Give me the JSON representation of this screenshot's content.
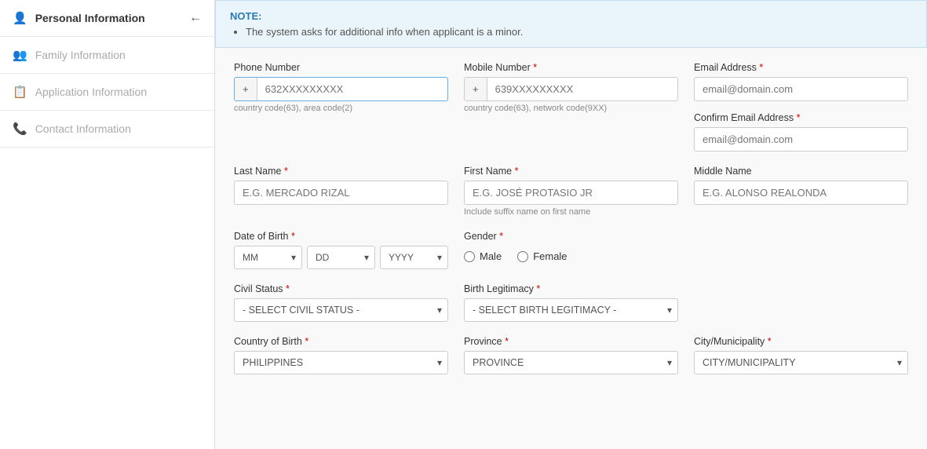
{
  "sidebar": {
    "items": [
      {
        "id": "personal",
        "label": "Personal Information",
        "icon": "👤",
        "active": true,
        "back": true,
        "disabled": false
      },
      {
        "id": "family",
        "label": "Family Information",
        "icon": "👥",
        "active": false,
        "back": false,
        "disabled": true
      },
      {
        "id": "application",
        "label": "Application Information",
        "icon": "📋",
        "active": false,
        "back": false,
        "disabled": true
      },
      {
        "id": "contact",
        "label": "Contact Information",
        "icon": "📞",
        "active": false,
        "back": false,
        "disabled": true
      }
    ]
  },
  "note": {
    "title": "NOTE:",
    "bullet": "The system asks for additional info when applicant is a minor."
  },
  "form": {
    "phone_number_label": "Phone Number",
    "phone_prefix": "+",
    "phone_placeholder": "632XXXXXXXXX",
    "phone_hint": "country code(63), area code(2)",
    "mobile_number_label": "Mobile Number",
    "mobile_required": true,
    "mobile_prefix": "+",
    "mobile_placeholder": "639XXXXXXXXX",
    "mobile_hint": "country code(63), network code(9XX)",
    "email_label": "Email Address",
    "email_required": true,
    "email_placeholder": "email@domain.com",
    "confirm_email_label": "Confirm Email Address",
    "confirm_email_required": true,
    "confirm_email_placeholder": "email@domain.com",
    "last_name_label": "Last Name",
    "last_name_required": true,
    "last_name_placeholder": "E.G. MERCADO RIZAL",
    "first_name_label": "First Name",
    "first_name_required": true,
    "first_name_placeholder": "E.G. JOSÉ PROTASIO JR",
    "first_name_hint": "Include suffix name on first name",
    "middle_name_label": "Middle Name",
    "middle_name_placeholder": "E.G. ALONSO REALONDA",
    "dob_label": "Date of Birth",
    "dob_required": true,
    "dob_mm": "MM",
    "dob_dd": "DD",
    "dob_yyyy": "YYYY",
    "gender_label": "Gender",
    "gender_required": true,
    "gender_options": [
      "Male",
      "Female"
    ],
    "civil_status_label": "Civil Status",
    "civil_status_required": true,
    "civil_status_placeholder": "- SELECT CIVIL STATUS -",
    "birth_legitimacy_label": "Birth Legitimacy",
    "birth_legitimacy_required": true,
    "birth_legitimacy_placeholder": "- SELECT BIRTH LEGITIMACY -",
    "country_label": "Country of Birth",
    "country_required": true,
    "country_value": "PHILIPPINES",
    "province_label": "Province",
    "province_required": true,
    "province_value": "PROVINCE",
    "city_label": "City/Municipality",
    "city_required": true,
    "city_value": "CITY/MUNICIPALITY"
  }
}
